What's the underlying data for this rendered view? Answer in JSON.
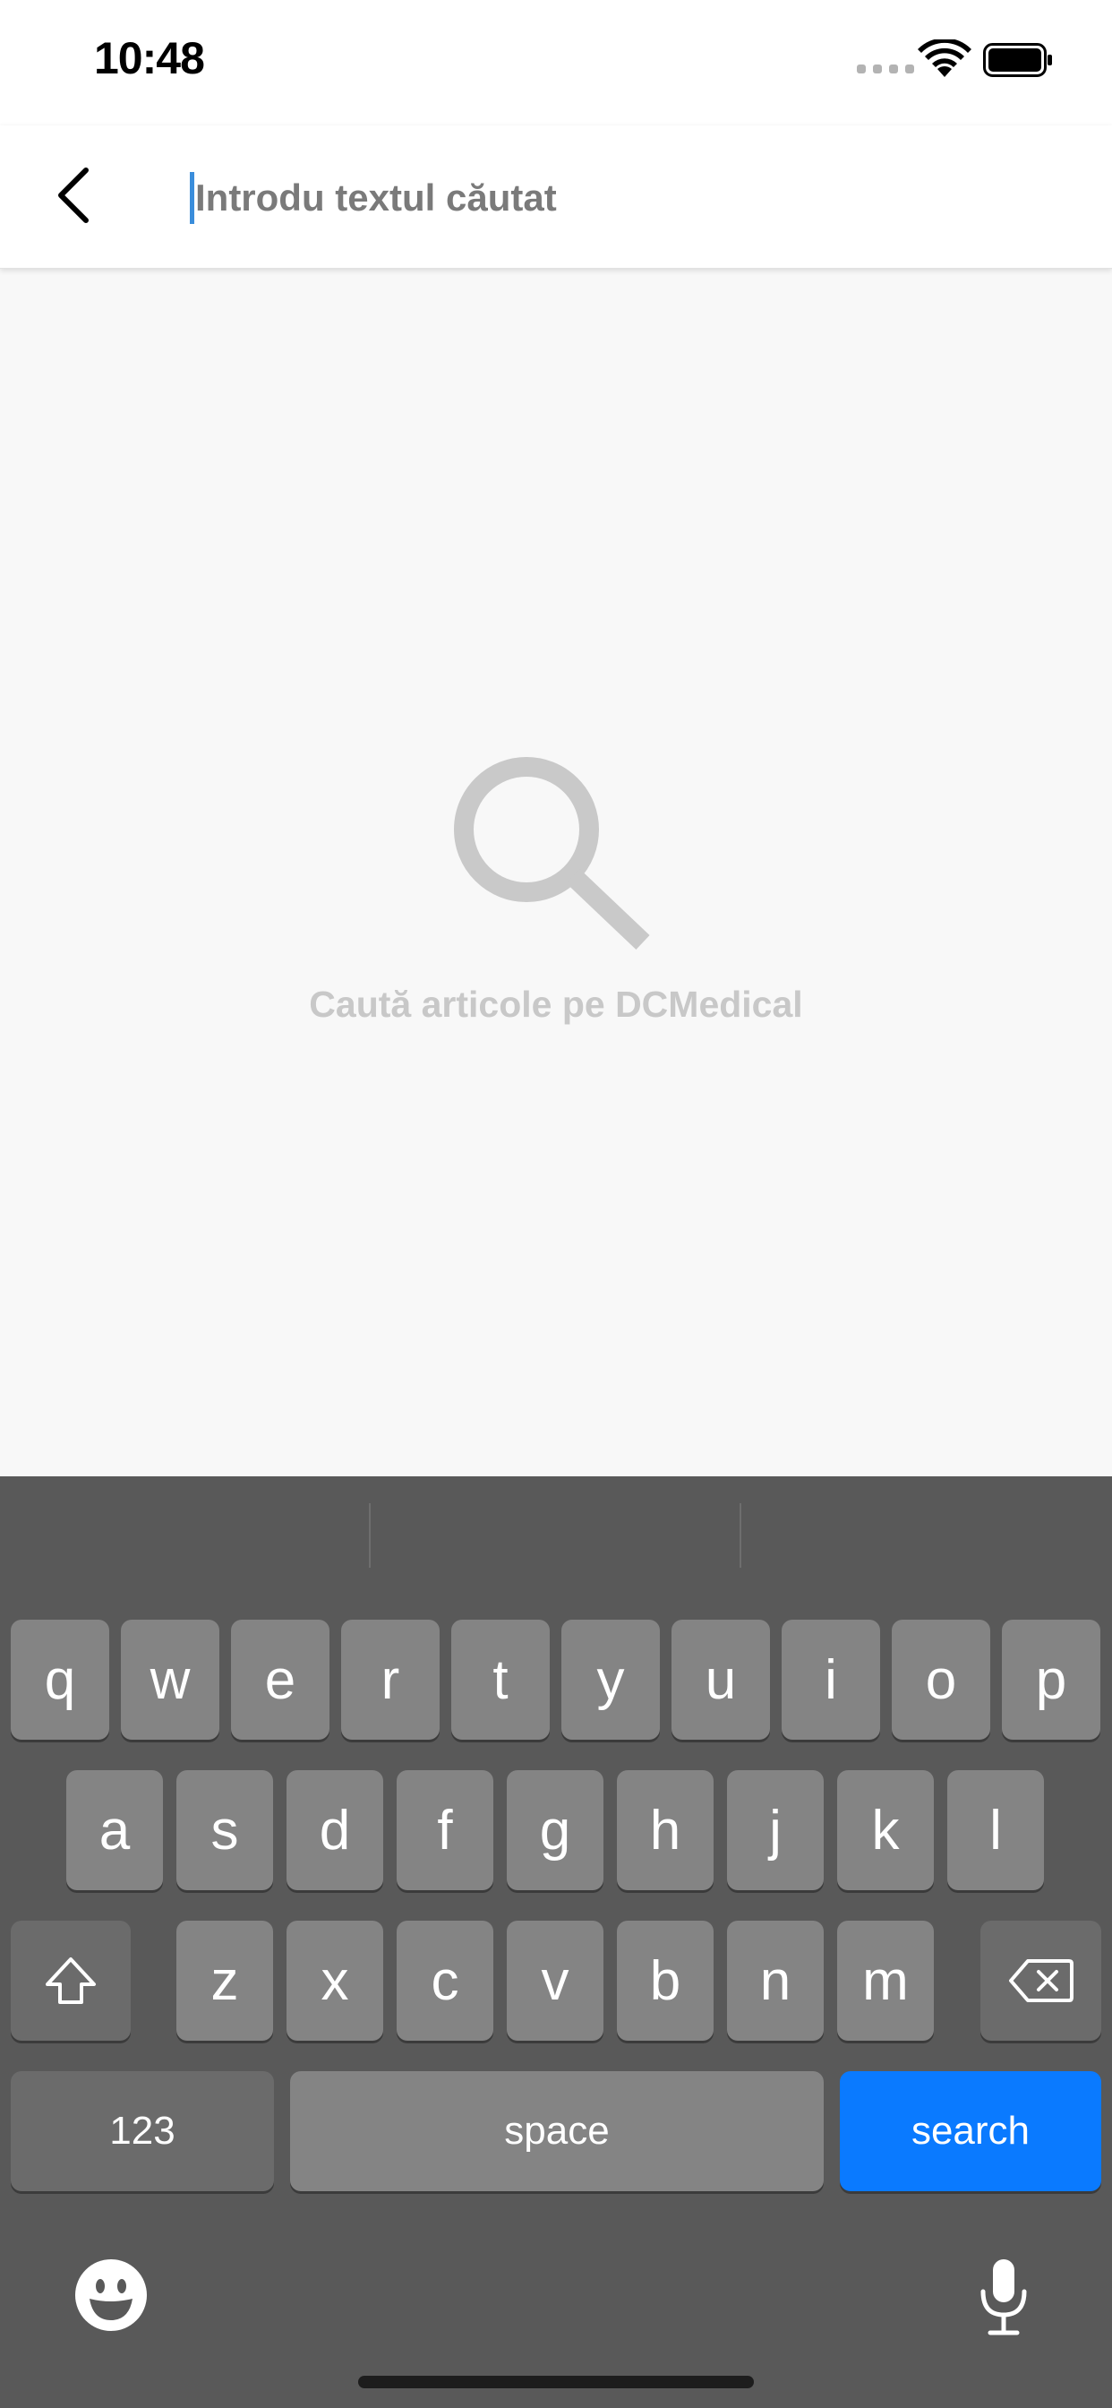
{
  "status_bar": {
    "time": "10:48"
  },
  "header": {
    "search_placeholder": "Introdu textul căutat"
  },
  "empty_state": {
    "label": "Caută articole pe DCMedical"
  },
  "keyboard": {
    "row1": [
      "q",
      "w",
      "e",
      "r",
      "t",
      "y",
      "u",
      "i",
      "o",
      "p"
    ],
    "row2": [
      "a",
      "s",
      "d",
      "f",
      "g",
      "h",
      "j",
      "k",
      "l"
    ],
    "row3": [
      "z",
      "x",
      "c",
      "v",
      "b",
      "n",
      "m"
    ],
    "numbers_key": "123",
    "space_key": "space",
    "search_key": "search"
  },
  "colors": {
    "accent": "#0a7aff",
    "caret": "#3a8ddb",
    "keyboard_bg": "#595959"
  }
}
